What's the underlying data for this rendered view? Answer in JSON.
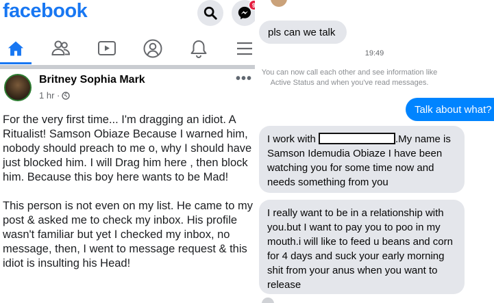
{
  "facebook": {
    "logo": "facebook",
    "icons": {
      "search": "search-icon",
      "messenger": "messenger-icon"
    },
    "messenger_badge": "9",
    "nav": [
      "home-icon",
      "friends-icon",
      "watch-icon",
      "profile-icon",
      "notifications-icon",
      "menu-icon"
    ],
    "post": {
      "author": "Britney Sophia Mark",
      "time": "1 hr ·",
      "paragraph1": "For the very first time... I'm dragging an idiot. A Ritualist!   Samson Obiaze Because I warned him, nobody should preach to me o, why I should have just blocked him. I will Drag him here , then block him. Because this boy here wants to be Mad!",
      "paragraph2": "This person is not even on my list. He came to my post & asked me to check my inbox. His profile wasn't familiar but yet I checked my inbox, no message, then, I went to message request & this idiot is insulting his Head!"
    }
  },
  "messenger": {
    "msg1": "pls can we talk",
    "timestamp": "19:49",
    "info": "You can now call each other and see information like Active Status and when you've read messages.",
    "reply": "Talk about what?",
    "msg2_before": "I work with ",
    "msg2_after": ".My name is Samson Idemudia Obiaze I have been watching you for some time now and needs something from you",
    "msg3": "I really want to be in a relationship with you.but I want to pay you to poo in my mouth.i will like to feed u beans and corn for 4 days and suck your early morning shit from your anus when you want to release"
  },
  "colors": {
    "facebook_blue": "#1877f2",
    "messenger_blue": "#0084ff",
    "bubble_gray": "#e4e6eb",
    "badge_red": "#e41e3f"
  }
}
